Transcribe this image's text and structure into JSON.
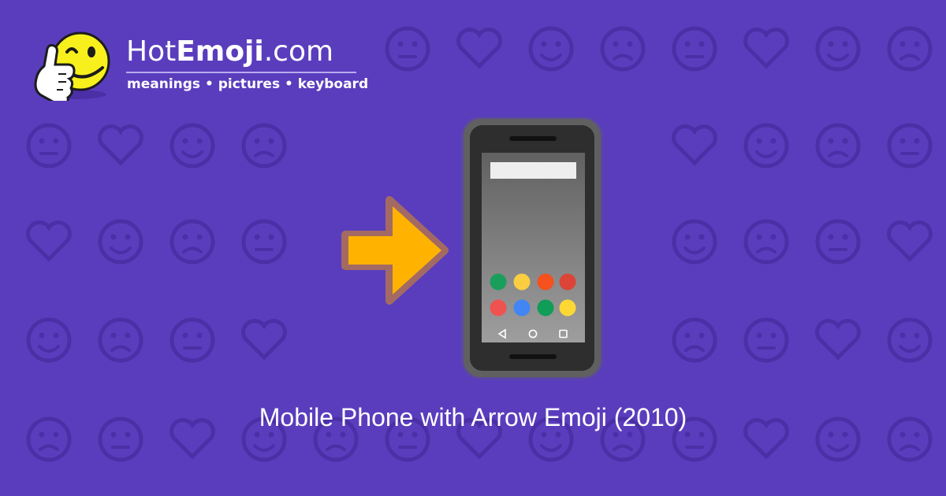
{
  "site": {
    "name_prefix": "Hot",
    "name_bold": "Emoji",
    "name_suffix": ".com",
    "tagline": "meanings • pictures • keyboard"
  },
  "emoji": {
    "caption": "Mobile Phone with Arrow Emoji (2010)"
  },
  "colors": {
    "background": "#5a3dbd",
    "pattern": "#4a2fa6",
    "arrow": "#ffb300",
    "phone_body": "#3b3b3b",
    "app_dots": [
      "#1a9e5b",
      "#fbcd41",
      "#f4511e",
      "#db4437",
      "#ef5350",
      "#4285f4",
      "#0f9d58",
      "#fdd835"
    ]
  },
  "icons": {
    "logo": "winking-thumbs-up-smiley-icon",
    "hero": "mobile-phone-with-arrow-icon",
    "nav": [
      "back-triangle-icon",
      "home-circle-icon",
      "recents-square-icon"
    ]
  }
}
